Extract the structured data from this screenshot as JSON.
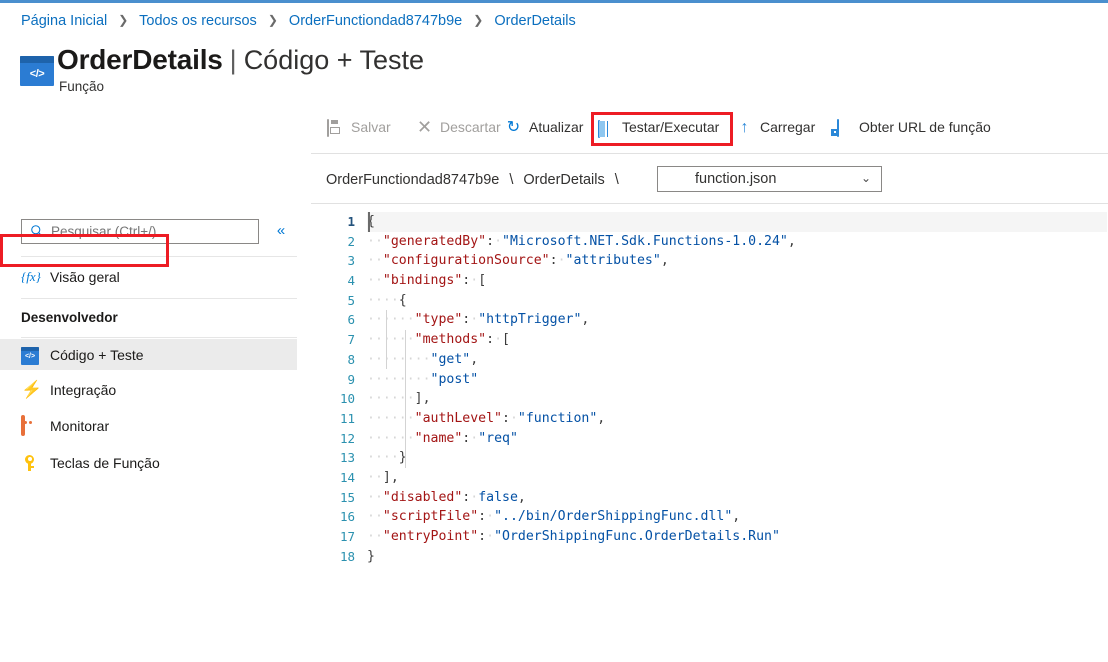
{
  "breadcrumb": {
    "items": [
      "Página Inicial",
      "Todos os recursos",
      "OrderFunctiondad8747b9e",
      "OrderDetails"
    ],
    "separator": "❯"
  },
  "header": {
    "icon": "code-function-icon",
    "title": "OrderDetails",
    "divider": "|",
    "section": "Código + Teste",
    "subtitle": "Função"
  },
  "sidebar": {
    "search": {
      "placeholder": "Pesquisar (Ctrl+/)",
      "value": "",
      "icon": "search-icon"
    },
    "collapse": {
      "icon": "double-chevron-left-icon",
      "label": "«"
    },
    "items": [
      {
        "label": "Visão geral",
        "icon": "fx-icon",
        "selected": false
      },
      {
        "label": "Código + Teste",
        "icon": "code-icon",
        "selected": true
      },
      {
        "label": "Integração",
        "icon": "lightning-bolt-icon",
        "selected": false
      },
      {
        "label": "Monitorar",
        "icon": "monitor-icon",
        "selected": false
      },
      {
        "label": "Teclas de Função",
        "icon": "key-icon",
        "selected": false
      }
    ],
    "section_header": "Desenvolvedor"
  },
  "toolbar": {
    "items": [
      {
        "label": "Salvar",
        "icon": "save-icon",
        "disabled": true,
        "highlighted": false
      },
      {
        "label": "Descartar",
        "icon": "close-x-icon",
        "disabled": true,
        "highlighted": false
      },
      {
        "label": "Atualizar",
        "icon": "refresh-icon",
        "disabled": false,
        "highlighted": false
      },
      {
        "label": "Testar/Executar",
        "icon": "test-run-icon",
        "disabled": false,
        "highlighted": true
      },
      {
        "label": "Carregar",
        "icon": "upload-arrow-icon",
        "disabled": false,
        "highlighted": false
      },
      {
        "label": "Obter URL de função",
        "icon": "get-url-icon",
        "disabled": false,
        "highlighted": false
      }
    ]
  },
  "pathbar": {
    "app": "OrderFunctiondad8747b9e",
    "separator": "\\",
    "function": "OrderDetails",
    "file_selected": "function.json",
    "chevron": "⌄"
  },
  "editor": {
    "language": "json",
    "line_numbers": [
      1,
      2,
      3,
      4,
      5,
      6,
      7,
      8,
      9,
      10,
      11,
      12,
      13,
      14,
      15,
      16,
      17,
      18
    ],
    "current_line": 1,
    "lines": [
      {
        "n": 1,
        "tokens": [
          {
            "t": "p",
            "v": "{"
          }
        ]
      },
      {
        "n": 2,
        "tokens": [
          {
            "t": "ws",
            "v": "··"
          },
          {
            "t": "k",
            "v": "\"generatedBy\""
          },
          {
            "t": "p",
            "v": ":"
          },
          {
            "t": "ws",
            "v": "·"
          },
          {
            "t": "s",
            "v": "\"Microsoft.NET.Sdk.Functions-1.0.24\""
          },
          {
            "t": "p",
            "v": ","
          }
        ]
      },
      {
        "n": 3,
        "tokens": [
          {
            "t": "ws",
            "v": "··"
          },
          {
            "t": "k",
            "v": "\"configurationSource\""
          },
          {
            "t": "p",
            "v": ":"
          },
          {
            "t": "ws",
            "v": "·"
          },
          {
            "t": "s",
            "v": "\"attributes\""
          },
          {
            "t": "p",
            "v": ","
          }
        ]
      },
      {
        "n": 4,
        "tokens": [
          {
            "t": "ws",
            "v": "··"
          },
          {
            "t": "k",
            "v": "\"bindings\""
          },
          {
            "t": "p",
            "v": ":"
          },
          {
            "t": "ws",
            "v": "·"
          },
          {
            "t": "p",
            "v": "["
          }
        ]
      },
      {
        "n": 5,
        "tokens": [
          {
            "t": "ws",
            "v": "····"
          },
          {
            "t": "p",
            "v": "{"
          }
        ]
      },
      {
        "n": 6,
        "tokens": [
          {
            "t": "ws",
            "v": "······"
          },
          {
            "t": "k",
            "v": "\"type\""
          },
          {
            "t": "p",
            "v": ":"
          },
          {
            "t": "ws",
            "v": "·"
          },
          {
            "t": "s",
            "v": "\"httpTrigger\""
          },
          {
            "t": "p",
            "v": ","
          }
        ]
      },
      {
        "n": 7,
        "tokens": [
          {
            "t": "ws",
            "v": "······"
          },
          {
            "t": "k",
            "v": "\"methods\""
          },
          {
            "t": "p",
            "v": ":"
          },
          {
            "t": "ws",
            "v": "·"
          },
          {
            "t": "p",
            "v": "["
          }
        ]
      },
      {
        "n": 8,
        "tokens": [
          {
            "t": "ws",
            "v": "········"
          },
          {
            "t": "s",
            "v": "\"get\""
          },
          {
            "t": "p",
            "v": ","
          }
        ]
      },
      {
        "n": 9,
        "tokens": [
          {
            "t": "ws",
            "v": "········"
          },
          {
            "t": "s",
            "v": "\"post\""
          }
        ]
      },
      {
        "n": 10,
        "tokens": [
          {
            "t": "ws",
            "v": "······"
          },
          {
            "t": "p",
            "v": "],"
          }
        ]
      },
      {
        "n": 11,
        "tokens": [
          {
            "t": "ws",
            "v": "······"
          },
          {
            "t": "k",
            "v": "\"authLevel\""
          },
          {
            "t": "p",
            "v": ":"
          },
          {
            "t": "ws",
            "v": "·"
          },
          {
            "t": "s",
            "v": "\"function\""
          },
          {
            "t": "p",
            "v": ","
          }
        ]
      },
      {
        "n": 12,
        "tokens": [
          {
            "t": "ws",
            "v": "······"
          },
          {
            "t": "k",
            "v": "\"name\""
          },
          {
            "t": "p",
            "v": ":"
          },
          {
            "t": "ws",
            "v": "·"
          },
          {
            "t": "s",
            "v": "\"req\""
          }
        ]
      },
      {
        "n": 13,
        "tokens": [
          {
            "t": "ws",
            "v": "····"
          },
          {
            "t": "p",
            "v": "}"
          }
        ]
      },
      {
        "n": 14,
        "tokens": [
          {
            "t": "ws",
            "v": "··"
          },
          {
            "t": "p",
            "v": "],"
          }
        ]
      },
      {
        "n": 15,
        "tokens": [
          {
            "t": "ws",
            "v": "··"
          },
          {
            "t": "k",
            "v": "\"disabled\""
          },
          {
            "t": "p",
            "v": ":"
          },
          {
            "t": "ws",
            "v": "·"
          },
          {
            "t": "lit",
            "v": "false"
          },
          {
            "t": "p",
            "v": ","
          }
        ]
      },
      {
        "n": 16,
        "tokens": [
          {
            "t": "ws",
            "v": "··"
          },
          {
            "t": "k",
            "v": "\"scriptFile\""
          },
          {
            "t": "p",
            "v": ":"
          },
          {
            "t": "ws",
            "v": "·"
          },
          {
            "t": "s",
            "v": "\"../bin/OrderShippingFunc.dll\""
          },
          {
            "t": "p",
            "v": ","
          }
        ]
      },
      {
        "n": 17,
        "tokens": [
          {
            "t": "ws",
            "v": "··"
          },
          {
            "t": "k",
            "v": "\"entryPoint\""
          },
          {
            "t": "p",
            "v": ":"
          },
          {
            "t": "ws",
            "v": "·"
          },
          {
            "t": "s",
            "v": "\"OrderShippingFunc.OrderDetails.Run\""
          }
        ]
      },
      {
        "n": 18,
        "tokens": [
          {
            "t": "p",
            "v": "}"
          }
        ]
      }
    ]
  },
  "colors": {
    "accent_blue": "#0078d4",
    "annotation_red": "#ed1c24",
    "json_key": "#a31515",
    "json_string": "#0451a5",
    "line_number": "#2b91af",
    "selected_nav_bg": "#ebebeb"
  }
}
